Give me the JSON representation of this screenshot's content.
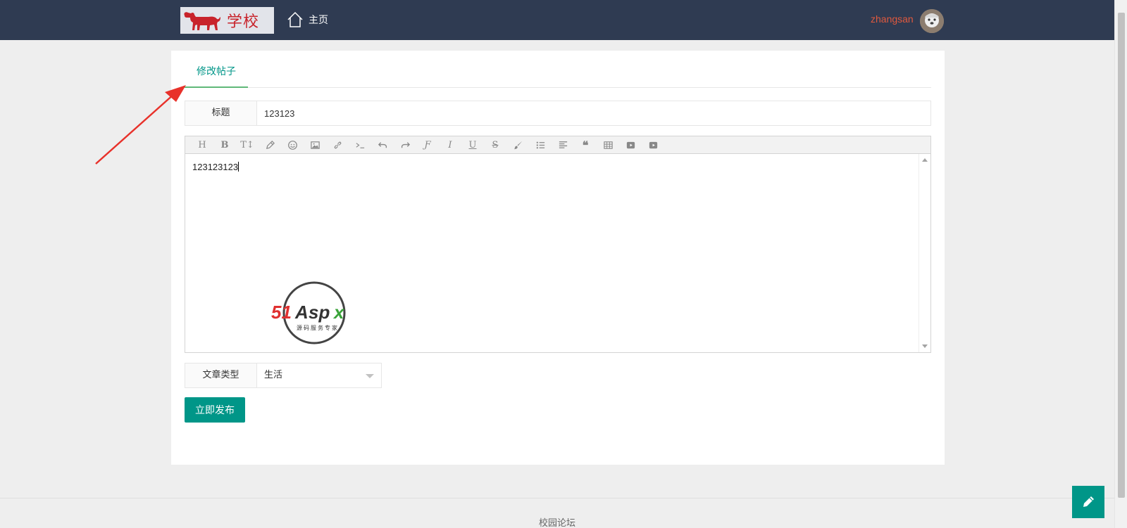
{
  "header": {
    "logo_text": "学校",
    "home_label": "主页",
    "username": "zhangsan"
  },
  "tabs": [
    {
      "label": "修改帖子",
      "active": true
    }
  ],
  "form": {
    "title_label": "标题",
    "title_value": "123123",
    "content_value": "123123123",
    "category_label": "文章类型",
    "category_value": "生活",
    "submit_label": "立即发布"
  },
  "editor_toolbar": [
    "heading-icon",
    "bold-icon",
    "font-size-icon",
    "pencil-icon",
    "emoji-icon",
    "image-icon",
    "link-icon",
    "code-icon",
    "undo-icon",
    "redo-icon",
    "font-family-icon",
    "italic-icon",
    "underline-icon",
    "strikethrough-icon",
    "brush-icon",
    "list-icon",
    "align-left-icon",
    "quote-icon",
    "table-icon",
    "video-icon",
    "video-icon"
  ],
  "watermark": {
    "brand": "51Aspx",
    "tagline": "源码服务专家"
  },
  "footer": {
    "text": "校园论坛"
  },
  "colors": {
    "accent": "#009688",
    "header_bg": "#2f3b52",
    "username": "#e0593e",
    "arrow": "#e8312a"
  }
}
